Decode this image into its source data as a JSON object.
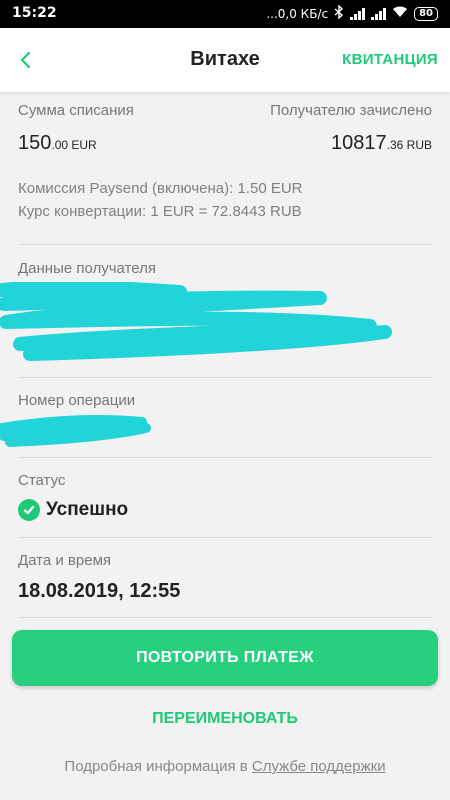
{
  "status_bar": {
    "time": "15:22",
    "network_speed": "...0,0 КБ/с",
    "battery": "80"
  },
  "header": {
    "title": "Витахе",
    "receipt_label": "КВИТАНЦИЯ",
    "back_icon": "chevron-left-icon"
  },
  "amounts": {
    "debit_label": "Сумма списания",
    "debit_value": "150",
    "debit_cents": ".00 EUR",
    "credit_label": "Получателю зачислено",
    "credit_value": "10817",
    "credit_cents": ".36 RUB"
  },
  "fees": {
    "commission": "Комиссия Paysend (включена): 1.50 EUR",
    "rate": "Курс конвертации: 1 EUR = 72.8443 RUB"
  },
  "recipient": {
    "label": "Данные получателя"
  },
  "operation": {
    "label": "Номер операции"
  },
  "status": {
    "label": "Статус",
    "value": "Успешно",
    "color": "#1fc97a"
  },
  "datetime": {
    "label": "Дата и время",
    "value": "18.08.2019, 12:55"
  },
  "actions": {
    "repeat_label": "ПОВТОРИТЬ ПЛАТЕЖ",
    "rename_label": "ПЕРЕИМЕНОВАТЬ"
  },
  "footer": {
    "text": "Подробная информация в ",
    "link": "Службе поддержки"
  },
  "colors": {
    "accent": "#1fc97a",
    "button": "#27d07e",
    "redaction": "#22d3d8"
  }
}
